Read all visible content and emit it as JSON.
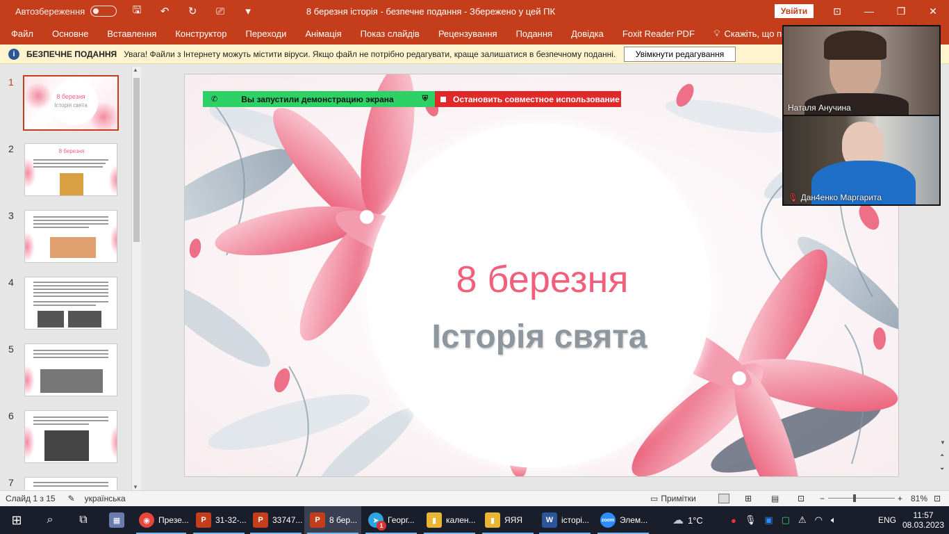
{
  "titlebar": {
    "autosave_label": "Автозбереження",
    "window_title": "8 березня історія  -  безпечне подання  -  Збережено у цей ПК",
    "signin_label": "Увійти"
  },
  "ribbon": {
    "tabs": [
      "Файл",
      "Основне",
      "Вставлення",
      "Конструктор",
      "Переходи",
      "Анімація",
      "Показ слайдів",
      "Рецензування",
      "Подання",
      "Довідка",
      "Foxit Reader PDF"
    ],
    "tell_me": "Скажіть, що потрібно зроб"
  },
  "protected_view": {
    "title": "БЕЗПЕЧНЕ ПОДАННЯ",
    "message": "Увага! Файли з Інтернету можуть містити віруси. Якщо файл не потрібно редагувати, краще залишатися в безпечному поданні.",
    "button": "Увімкнути редагування"
  },
  "thumbnails": {
    "numbers": [
      "1",
      "2",
      "3",
      "4",
      "5",
      "6",
      "7"
    ],
    "slide1_title": "8 березня",
    "slide1_subtitle": "Історія свята",
    "slide2_title": "8 березня"
  },
  "slide": {
    "title": "8 березня",
    "subtitle": "Історія свята"
  },
  "share_bar": {
    "sharing_label": "Вы запустили демонстрацию экрана",
    "stop_label": "Остановить совместное использование"
  },
  "videos": {
    "participant1": "Наталя Анучина",
    "participant2": "Дан4енко Маргарита"
  },
  "status_bar": {
    "slide_info": "Слайд 1 з 15",
    "language": "українська",
    "notes_label": "Примітки",
    "zoom": "81%"
  },
  "taskbar": {
    "items": [
      "Презе...",
      "31-32-...",
      "33747...",
      "8 бер...",
      "Георг...",
      "кален...",
      "ЯЯЯ",
      "історі...",
      "Элем..."
    ],
    "telegram_badge": "1",
    "weather": "1°C",
    "lang": "ENG",
    "time": "11:57",
    "date": "08.03.2023"
  },
  "colors": {
    "accent": "#c43e1c",
    "slide_title": "#f25f7b",
    "slide_subtitle": "#8e969e",
    "share_green": "#2ed165",
    "share_red": "#e02a2a"
  }
}
